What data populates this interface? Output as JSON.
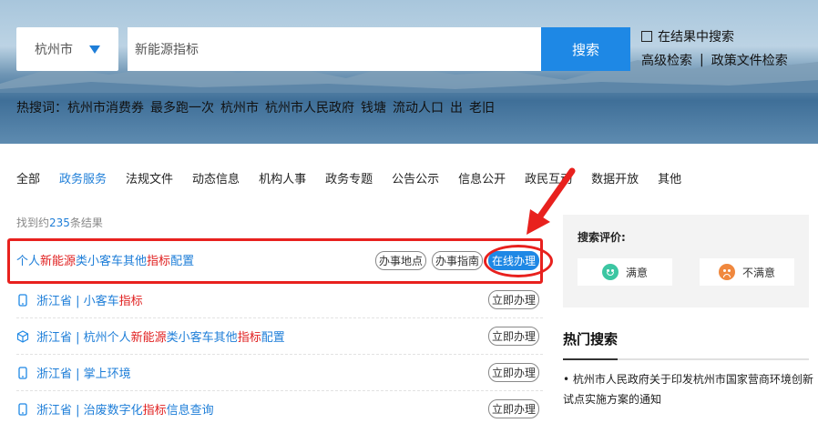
{
  "search": {
    "city": "杭州市",
    "query": "新能源指标",
    "button": "搜索",
    "in_result": "在结果中搜索",
    "advanced": "高级检索",
    "separator": "|",
    "policy": "政策文件检索"
  },
  "hot_words": {
    "label": "热搜词：",
    "items": [
      "杭州市消费券",
      "最多跑一次",
      "杭州市",
      "杭州市人民政府",
      "钱塘",
      "流动人口",
      "出",
      "老旧"
    ]
  },
  "tabs": [
    "全部",
    "政务服务",
    "法规文件",
    "动态信息",
    "机构人事",
    "政务专题",
    "公告公示",
    "信息公开",
    "政民互动",
    "数据开放",
    "其他"
  ],
  "active_tab": "政务服务",
  "result_count": {
    "prefix": "找到约",
    "num": "235",
    "suffix": "条结果"
  },
  "results": [
    {
      "parts": [
        {
          "t": "个人",
          "hl": false
        },
        {
          "t": "新能源",
          "hl": true
        },
        {
          "t": "类小客车其他",
          "hl": false
        },
        {
          "t": "指标",
          "hl": true
        },
        {
          "t": "配置",
          "hl": false
        }
      ],
      "icon": "none",
      "actions": [
        "办事地点",
        "办事指南",
        "在线办理"
      ]
    },
    {
      "parts": [
        {
          "t": "浙江省 | 小客车",
          "hl": false
        },
        {
          "t": "指标",
          "hl": true
        }
      ],
      "icon": "phone-icon",
      "actions": [
        "立即办理"
      ]
    },
    {
      "parts": [
        {
          "t": "浙江省 | 杭州个人",
          "hl": false
        },
        {
          "t": "新能源",
          "hl": true
        },
        {
          "t": "类小客车其他",
          "hl": false
        },
        {
          "t": "指标",
          "hl": true
        },
        {
          "t": "配置",
          "hl": false
        }
      ],
      "icon": "cube-icon",
      "actions": [
        "立即办理"
      ]
    },
    {
      "parts": [
        {
          "t": "浙江省 | 掌上环境",
          "hl": false
        }
      ],
      "icon": "phone-icon",
      "actions": [
        "立即办理"
      ]
    },
    {
      "parts": [
        {
          "t": "浙江省 | 治废数字化",
          "hl": false
        },
        {
          "t": "指标",
          "hl": true
        },
        {
          "t": "信息查询",
          "hl": false
        }
      ],
      "icon": "phone-icon",
      "actions": [
        "立即办理"
      ]
    }
  ],
  "rating": {
    "title": "搜索评价:",
    "good": "满意",
    "bad": "不满意"
  },
  "hot_search": {
    "title": "热门搜索",
    "item": "• 杭州市人民政府关于印发杭州市国家营商环境创新试点实施方案的通知"
  },
  "colors": {
    "accent": "#1e88e5",
    "highlight": "#e02020",
    "annotation": "#e8211e"
  }
}
